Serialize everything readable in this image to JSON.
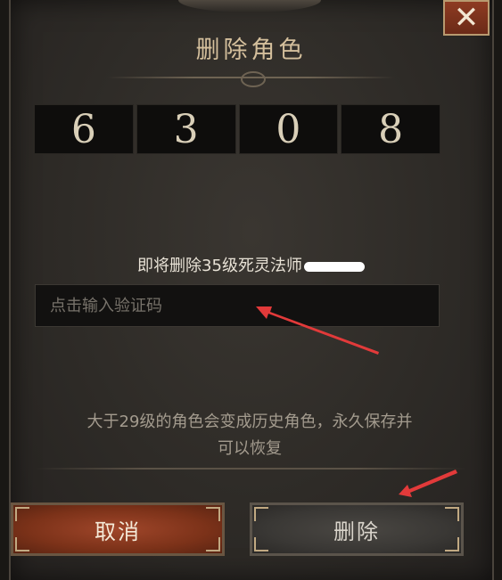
{
  "dialog": {
    "title": "删除角色",
    "close_icon": "close-icon",
    "verification_digits": [
      "6",
      "3",
      "0",
      "8"
    ],
    "warning_text": "即将删除35级死灵法师",
    "input_placeholder": "点击输入验证码",
    "input_value": "",
    "info_line1": "大于29级的角色会变成历史角色，永久保存并",
    "info_line2": "可以恢复",
    "cancel_label": "取消",
    "delete_label": "删除"
  },
  "colors": {
    "accent_cancel": "#8e3b22",
    "annotation_arrow": "#e23a3a"
  }
}
